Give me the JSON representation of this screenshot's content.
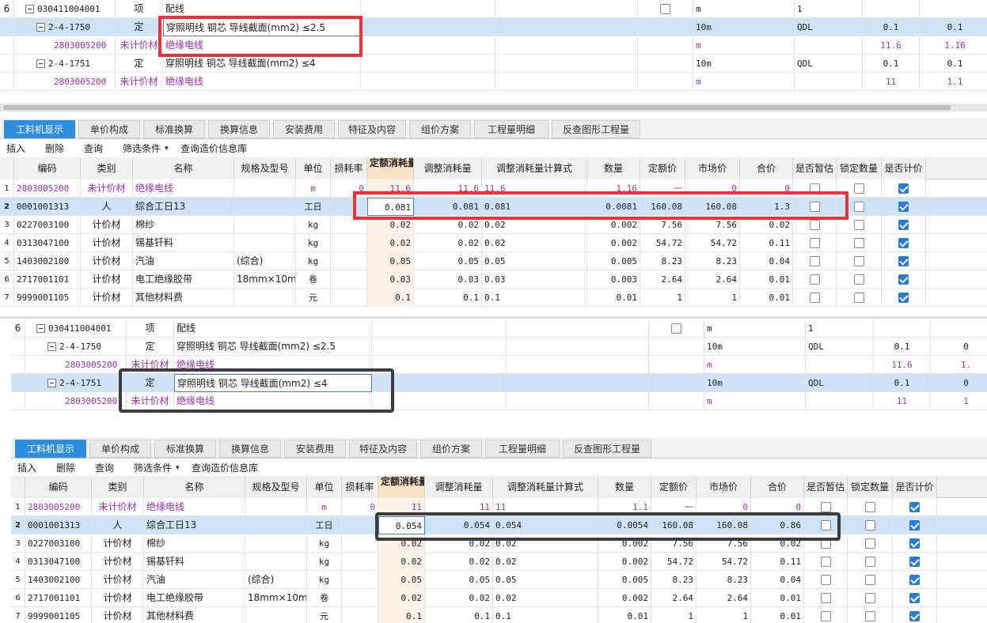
{
  "panel1": {
    "top_rows": [
      {
        "num": "6",
        "code": "030411004001",
        "type": "项",
        "name": "配线",
        "unit": "m",
        "v1": "1",
        "v2": "",
        "v3": ""
      },
      {
        "num": "",
        "code": "2-4-1750",
        "type": "定",
        "name": "穿照明线 铜芯 导线截面(mm2) ≤2.5",
        "unit": "10m",
        "v1": "QDL",
        "v2": "0.1",
        "v3": "0.1"
      },
      {
        "num": "",
        "code": "2803005200",
        "type": "未计价材",
        "name": "绝缘电线",
        "unit": "m",
        "v1": "",
        "v2": "11.6",
        "v3": "1.16"
      },
      {
        "num": "",
        "code": "2-4-1751",
        "type": "定",
        "name": "穿照明线 铜芯 导线截面(mm2) ≤4",
        "unit": "10m",
        "v1": "QDL",
        "v2": "0.1",
        "v3": "0.1"
      },
      {
        "num": "",
        "code": "2803005200",
        "type": "未计价材",
        "name": "绝缘电线",
        "unit": "m",
        "v1": "",
        "v2": "11",
        "v3": "1.1"
      }
    ],
    "tabs": [
      "工料机显示",
      "单价构成",
      "标准换算",
      "换算信息",
      "安装费用",
      "特征及内容",
      "组价方案",
      "工程量明细",
      "反查图形工程量"
    ],
    "toolbar": [
      "插入",
      "删除",
      "查询",
      "筛选条件",
      "查询造价信息库"
    ],
    "headers": [
      "编码",
      "类别",
      "名称",
      "规格及型号",
      "单位",
      "损耗率",
      "定额消耗量",
      "调整消耗量",
      "调整消耗量计算式",
      "数量",
      "定额价",
      "市场价",
      "合价",
      "是否暂估",
      "锁定数量",
      "是否计价"
    ],
    "rows": [
      {
        "n": "1",
        "code": "2803005200",
        "cat": "未计价材",
        "name": "绝缘电线",
        "spec": "",
        "unit": "m",
        "loss": "0",
        "qty": "11.6",
        "adj": "11.6",
        "formula": "11.6",
        "amount": "1.16",
        "price": "一",
        "market": "0",
        "total": "0",
        "calc": true
      },
      {
        "n": "2",
        "code": "0001001313",
        "cat": "人",
        "name": "综合工日13",
        "spec": "",
        "unit": "工日",
        "loss": "",
        "qty": "0.081",
        "adj": "0.081",
        "formula": "0.081",
        "amount": "0.0081",
        "price": "160.08",
        "market": "160.08",
        "total": "1.3",
        "calc": true
      },
      {
        "n": "3",
        "code": "0227003100",
        "cat": "计价材",
        "name": "棉纱",
        "spec": "",
        "unit": "kg",
        "loss": "",
        "qty": "0.02",
        "adj": "0.02",
        "formula": "0.02",
        "amount": "0.002",
        "price": "7.56",
        "market": "7.56",
        "total": "0.02",
        "calc": true
      },
      {
        "n": "4",
        "code": "0313047100",
        "cat": "计价材",
        "name": "锡基钎料",
        "spec": "",
        "unit": "kg",
        "loss": "",
        "qty": "0.02",
        "adj": "0.02",
        "formula": "0.02",
        "amount": "0.002",
        "price": "54.72",
        "market": "54.72",
        "total": "0.11",
        "calc": true
      },
      {
        "n": "5",
        "code": "1403002100",
        "cat": "计价材",
        "name": "汽油",
        "spec": "(综合)",
        "unit": "kg",
        "loss": "",
        "qty": "0.05",
        "adj": "0.05",
        "formula": "0.05",
        "amount": "0.005",
        "price": "8.23",
        "market": "8.23",
        "total": "0.04",
        "calc": true
      },
      {
        "n": "6",
        "code": "2717001101",
        "cat": "计价材",
        "name": "电工绝缘胶带",
        "spec": "18mm×10m…",
        "unit": "卷",
        "loss": "",
        "qty": "0.03",
        "adj": "0.03",
        "formula": "0.03",
        "amount": "0.003",
        "price": "2.64",
        "market": "2.64",
        "total": "0.01",
        "calc": true
      },
      {
        "n": "7",
        "code": "9999001105",
        "cat": "计价材",
        "name": "其他材料费",
        "spec": "",
        "unit": "元",
        "loss": "",
        "qty": "0.1",
        "adj": "0.1",
        "formula": "0.1",
        "amount": "0.01",
        "price": "1",
        "market": "1",
        "total": "0.01",
        "calc": true
      }
    ]
  },
  "panel2": {
    "top_rows": [
      {
        "num": "6",
        "code": "030411004001",
        "type": "项",
        "name": "配线",
        "unit": "m",
        "v1": "1",
        "v2": "",
        "v3": ""
      },
      {
        "num": "",
        "code": "2-4-1750",
        "type": "定",
        "name": "穿照明线 铜芯 导线截面(mm2) ≤2.5",
        "unit": "10m",
        "v1": "QDL",
        "v2": "0.1",
        "v3": "0"
      },
      {
        "num": "",
        "code": "2803005200",
        "type": "未计价材",
        "name": "绝缘电线",
        "unit": "m",
        "v1": "",
        "v2": "11.6",
        "v3": "1."
      },
      {
        "num": "",
        "code": "2-4-1751",
        "type": "定",
        "name": "穿照明线 铜芯 导线截面(mm2) ≤4",
        "unit": "10m",
        "v1": "QDL",
        "v2": "0.1",
        "v3": "0"
      },
      {
        "num": "",
        "code": "2803005200",
        "type": "未计价材",
        "name": "绝缘电线",
        "unit": "m",
        "v1": "",
        "v2": "11",
        "v3": "1"
      }
    ],
    "tabs": [
      "工料机显示",
      "单价构成",
      "标准换算",
      "换算信息",
      "安装费用",
      "特征及内容",
      "组价方案",
      "工程量明细",
      "反查图形工程量"
    ],
    "toolbar": [
      "插入",
      "删除",
      "查询",
      "筛选条件",
      "查询造价信息库"
    ],
    "headers": [
      "编码",
      "类别",
      "名称",
      "规格及型号",
      "单位",
      "损耗率",
      "定额消耗量",
      "调整消耗量",
      "调整消耗量计算式",
      "数量",
      "定额价",
      "市场价",
      "合价",
      "是否暂估",
      "锁定数量",
      "是否计价"
    ],
    "rows": [
      {
        "n": "1",
        "code": "2803005200",
        "cat": "未计价材",
        "name": "绝缘电线",
        "spec": "",
        "unit": "m",
        "loss": "0",
        "qty": "11",
        "adj": "11",
        "formula": "11",
        "amount": "1.1",
        "price": "一",
        "market": "0",
        "total": "0",
        "calc": true
      },
      {
        "n": "2",
        "code": "0001001313",
        "cat": "人",
        "name": "综合工日13",
        "spec": "",
        "unit": "工日",
        "loss": "",
        "qty": "0.054",
        "adj": "0.054",
        "formula": "0.054",
        "amount": "0.0054",
        "price": "160.08",
        "market": "160.08",
        "total": "0.86",
        "calc": true
      },
      {
        "n": "3",
        "code": "0227003100",
        "cat": "计价材",
        "name": "棉纱",
        "spec": "",
        "unit": "kg",
        "loss": "",
        "qty": "0.02",
        "adj": "0.02",
        "formula": "0.02",
        "amount": "0.002",
        "price": "7.56",
        "market": "7.56",
        "total": "0.02",
        "calc": true
      },
      {
        "n": "4",
        "code": "0313047100",
        "cat": "计价材",
        "name": "锡基钎料",
        "spec": "",
        "unit": "kg",
        "loss": "",
        "qty": "0.02",
        "adj": "0.02",
        "formula": "0.02",
        "amount": "0.002",
        "price": "54.72",
        "market": "54.72",
        "total": "0.11",
        "calc": true
      },
      {
        "n": "5",
        "code": "1403002100",
        "cat": "计价材",
        "name": "汽油",
        "spec": "(综合)",
        "unit": "kg",
        "loss": "",
        "qty": "0.05",
        "adj": "0.05",
        "formula": "0.05",
        "amount": "0.005",
        "price": "8.23",
        "market": "8.23",
        "total": "0.04",
        "calc": true
      },
      {
        "n": "6",
        "code": "2717001101",
        "cat": "计价材",
        "name": "电工绝缘胶带",
        "spec": "18mm×10m…",
        "unit": "卷",
        "loss": "",
        "qty": "0.02",
        "adj": "0.02",
        "formula": "0.02",
        "amount": "0.002",
        "price": "2.64",
        "market": "2.64",
        "total": "0.01",
        "calc": true
      },
      {
        "n": "7",
        "code": "9999001105",
        "cat": "计价材",
        "name": "其他材料费",
        "spec": "",
        "unit": "元",
        "loss": "",
        "qty": "0.1",
        "adj": "0.1",
        "formula": "0.1",
        "amount": "0.01",
        "price": "1",
        "market": "1",
        "total": "0.01",
        "calc": true
      }
    ]
  }
}
